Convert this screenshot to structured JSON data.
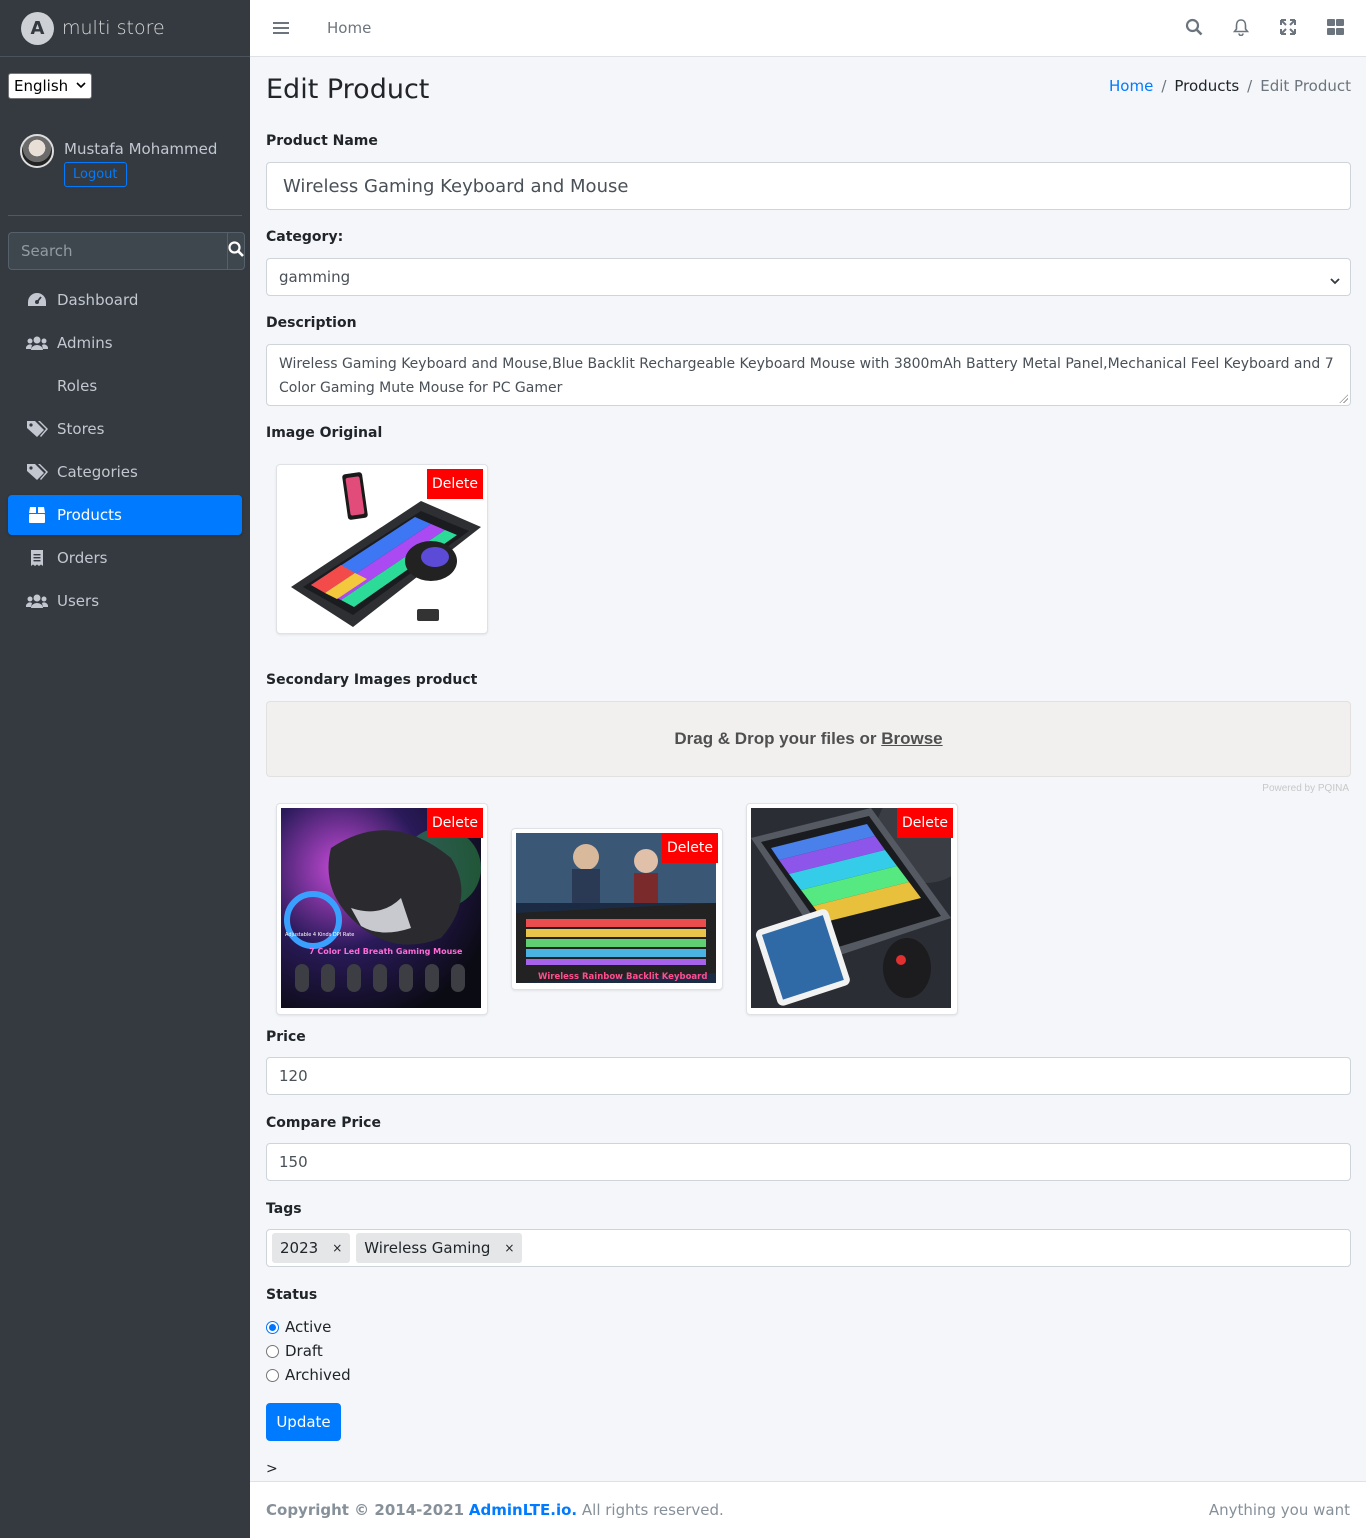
{
  "brand": {
    "logo_letter": "A",
    "name": "multi store"
  },
  "language": {
    "selected": "English"
  },
  "user": {
    "name": "Mustafa Mohammed",
    "logout_label": "Logout"
  },
  "sidebar_search": {
    "placeholder": "Search"
  },
  "nav": [
    {
      "label": "Dashboard",
      "icon": "dashboard-icon",
      "active": false
    },
    {
      "label": "Admins",
      "icon": "users-icon",
      "active": false
    },
    {
      "label": "Roles",
      "icon": "",
      "active": false
    },
    {
      "label": "Stores",
      "icon": "tags-icon",
      "active": false
    },
    {
      "label": "Categories",
      "icon": "tags-icon",
      "active": false
    },
    {
      "label": "Products",
      "icon": "box-icon",
      "active": true
    },
    {
      "label": "Orders",
      "icon": "receipt-icon",
      "active": false
    },
    {
      "label": "Users",
      "icon": "users-icon",
      "active": false
    }
  ],
  "topbar": {
    "home_label": "Home"
  },
  "page": {
    "title": "Edit Product",
    "breadcrumb": {
      "home": "Home",
      "section": "Products",
      "current": "Edit Product"
    }
  },
  "form": {
    "product_name_label": "Product Name",
    "product_name_value": "Wireless Gaming Keyboard and Mouse",
    "category_label": "Category:",
    "category_value": "gamming",
    "description_label": "Description",
    "description_value": "Wireless Gaming Keyboard and Mouse,Blue Backlit Rechargeable Keyboard Mouse with 3800mAh Battery Metal Panel,Mechanical Feel Keyboard and 7 Color Gaming Mute Mouse for PC Gamer",
    "image_original_label": "Image Original",
    "delete_label": "Delete",
    "secondary_images_label": "Secondary Images product",
    "dropzone_text": "Drag & Drop your files or",
    "dropzone_browse": "Browse",
    "powered_by": "Powered by PQINA",
    "secondary_image_captions": [
      "Adjustable 4 Kinds DPI Rate",
      "7 Color Led Breath Gaming Mouse",
      "Wireless Rainbow Backlit Keyboard"
    ],
    "price_label": "Price",
    "price_value": "120",
    "compare_price_label": "Compare Price",
    "compare_price_value": "150",
    "tags_label": "Tags",
    "tags": [
      "2023",
      "Wireless Gaming"
    ],
    "tag_remove": "×",
    "status_label": "Status",
    "status_options": [
      "Active",
      "Draft",
      "Archived"
    ],
    "status_selected": "Active",
    "update_label": "Update",
    "stray_text": ">"
  },
  "footer": {
    "copyright_prefix": "Copyright © 2014-2021",
    "link": "AdminLTE.io.",
    "suffix": "All rights reserved.",
    "right": "Anything you want"
  },
  "colors": {
    "primary": "#007bff",
    "sidebar": "#343a40",
    "delete": "#ff0000"
  }
}
